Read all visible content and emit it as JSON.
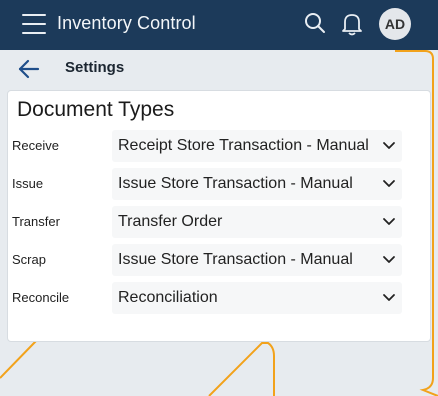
{
  "app": {
    "title": "Inventory Control",
    "user_initials": "AD",
    "accent_color": "#1c3a5a",
    "highlight_color": "#f2a21b"
  },
  "icons": {
    "menu": "hamburger-icon",
    "search": "search-icon",
    "notifications": "bell-icon",
    "back": "arrow-left-icon",
    "dropdown": "chevron-down-icon"
  },
  "page": {
    "title": "Settings"
  },
  "document_types": {
    "heading": "Document Types",
    "rows": [
      {
        "label": "Receive",
        "value": "Receipt Store Transaction - Manual"
      },
      {
        "label": "Issue",
        "value": "Issue Store Transaction - Manual"
      },
      {
        "label": "Transfer",
        "value": "Transfer Order"
      },
      {
        "label": "Scrap",
        "value": "Issue Store Transaction - Manual"
      },
      {
        "label": "Reconcile",
        "value": "Reconciliation"
      }
    ]
  }
}
